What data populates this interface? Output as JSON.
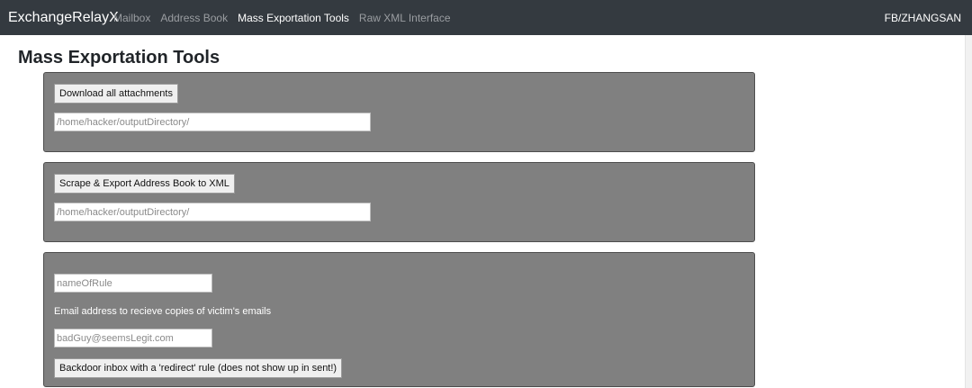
{
  "navbar": {
    "brand": "ExchangeRelayX",
    "links": [
      {
        "label": "Mailbox"
      },
      {
        "label": "Address Book"
      },
      {
        "label": "Mass Exportation Tools"
      },
      {
        "label": "Raw XML Interface"
      }
    ],
    "user": "FB/ZHANGSAN"
  },
  "page": {
    "title": "Mass Exportation Tools"
  },
  "attachments_panel": {
    "button_label": "Download all attachments",
    "path_placeholder": "/home/hacker/outputDirectory/"
  },
  "address_book_panel": {
    "button_label": "Scrape & Export Address Book to XML",
    "path_placeholder": "/home/hacker/outputDirectory/"
  },
  "rule_panel": {
    "rule_name_placeholder": "nameOfRule",
    "email_label": "Email address to recieve copies of victim's emails",
    "email_placeholder": "badGuy@seemsLegit.com",
    "button_label": "Backdoor inbox with a 'redirect' rule (does not show up in sent!)"
  }
}
